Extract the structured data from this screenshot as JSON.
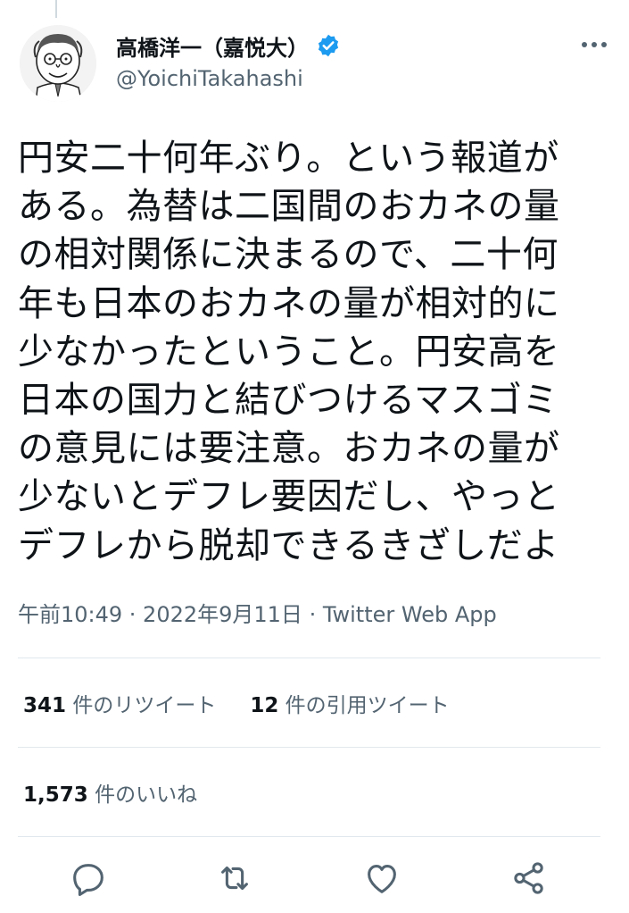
{
  "tweet": {
    "author": {
      "display_name": "高橋洋一（嘉悦大）",
      "handle": "@YoichiTakahashi",
      "verified": true
    },
    "text_lines": [
      "円安二十何年ぶり。という報道が",
      "ある。為替は二国間のおカネの量",
      "の相対関係に決まるので、二十何",
      "年も日本のおカネの量が相対的に",
      "少なかったということ。円安高を",
      "日本の国力と結びつけるマスゴミ",
      "の意見には要注意。おカネの量が",
      "少ないとデフレ要因だし、やっと",
      "デフレから脱却できるきざしだよ"
    ],
    "meta": "午前10:49 · 2022年9月11日 · Twitter Web App",
    "stats": {
      "retweets_count": "341",
      "retweets_label": " 件のリツイート",
      "quotes_count": "12",
      "quotes_label": " 件の引用ツイート",
      "likes_count": "1,573",
      "likes_label": " 件のいいね"
    }
  },
  "icons": {
    "more": "more-horizontal-icon",
    "verified": "verified-badge-icon",
    "reply": "reply-icon",
    "retweet": "retweet-icon",
    "like": "heart-icon",
    "share": "share-icon"
  },
  "colors": {
    "text": "#0f1419",
    "secondary": "#536471",
    "verified": "#1d9bf0",
    "divider": "#e1e8ed"
  }
}
